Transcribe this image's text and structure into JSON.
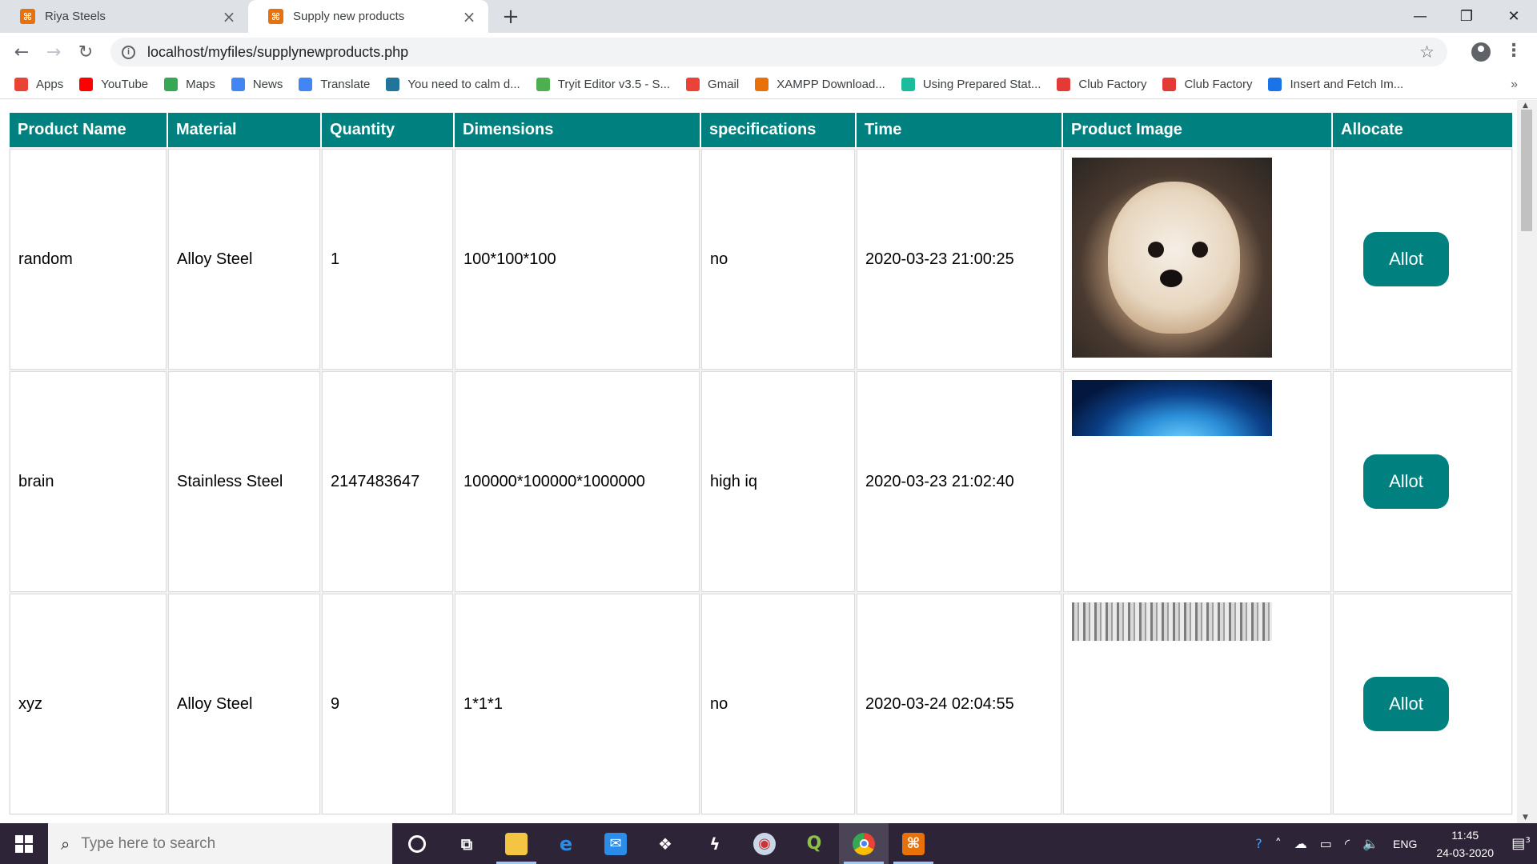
{
  "browser": {
    "tabs": [
      {
        "title": "Riya Steels",
        "active": false
      },
      {
        "title": "Supply new products",
        "active": true
      }
    ],
    "url": "localhost/myfiles/supplynewproducts.php",
    "bookmarks": [
      {
        "label": "Apps",
        "icon": "apps-grid-icon",
        "color": "#ea4335"
      },
      {
        "label": "YouTube",
        "icon": "youtube-icon",
        "color": "#ff0000"
      },
      {
        "label": "Maps",
        "icon": "maps-icon",
        "color": "#34a853"
      },
      {
        "label": "News",
        "icon": "news-icon",
        "color": "#4285f4"
      },
      {
        "label": "Translate",
        "icon": "translate-icon",
        "color": "#4285f4"
      },
      {
        "label": "You need to calm d...",
        "icon": "wordpress-icon",
        "color": "#21759b"
      },
      {
        "label": "Tryit Editor v3.5 - S...",
        "icon": "w3schools-icon",
        "color": "#4caf50"
      },
      {
        "label": "Gmail",
        "icon": "gmail-icon",
        "color": "#ea4335"
      },
      {
        "label": "XAMPP Download...",
        "icon": "xampp-icon",
        "color": "#e8710a"
      },
      {
        "label": "Using Prepared Stat...",
        "icon": "prepared-stat-icon",
        "color": "#1abc9c"
      },
      {
        "label": "Club Factory",
        "icon": "club-factory-icon",
        "color": "#e53935"
      },
      {
        "label": "Club Factory",
        "icon": "club-factory-icon",
        "color": "#e53935"
      },
      {
        "label": "Insert and Fetch Im...",
        "icon": "w-icon",
        "color": "#1a73e8"
      }
    ],
    "bookmarks_more": "»"
  },
  "table": {
    "headers": [
      "Product Name",
      "Material",
      "Quantity",
      "Dimensions",
      "specifications",
      "Time",
      "Product Image",
      "Allocate"
    ],
    "rows": [
      {
        "name": "random",
        "material": "Alloy Steel",
        "quantity": "1",
        "dimensions": "100*100*100",
        "specifications": "no",
        "time": "2020-03-23 21:00:25",
        "image": "dog-photo",
        "action": "Allot"
      },
      {
        "name": "brain",
        "material": "Stainless Steel",
        "quantity": "2147483647",
        "dimensions": "100000*100000*1000000",
        "specifications": "high iq",
        "time": "2020-03-23 21:02:40",
        "image": "brain-photo",
        "action": "Allot"
      },
      {
        "name": "xyz",
        "material": "Alloy Steel",
        "quantity": "9",
        "dimensions": "1*1*1",
        "specifications": "no",
        "time": "2020-03-24 02:04:55",
        "image": "document-photo",
        "action": "Allot"
      }
    ]
  },
  "taskbar": {
    "search_placeholder": "Type here to search",
    "lang": "ENG",
    "time": "11:45",
    "date": "24-03-2020",
    "notifications": "3"
  },
  "colors": {
    "accent": "#018080",
    "tabstrip": "#dee1e6",
    "taskbar": "#2d2438"
  }
}
